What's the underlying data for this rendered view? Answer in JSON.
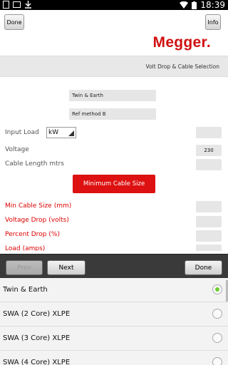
{
  "statusbar": {
    "time": "18:39"
  },
  "toolbar": {
    "done_label": "Done",
    "info_label": "Info"
  },
  "brand": {
    "logo_text": "Megger",
    "logo_dot": "."
  },
  "header": {
    "title": "Volt Drop & Cable Selection"
  },
  "form": {
    "cable_type": "Twin & Earth",
    "ref_method": "Ref method B",
    "input_load_label": "Input Load",
    "input_load_unit": "kW",
    "input_load_value": "",
    "voltage_label": "Voltage",
    "voltage_value": "230",
    "cable_length_label": "Cable Length mtrs",
    "cable_length_value": "",
    "min_cable_button": "Minimum Cable Size",
    "results": [
      {
        "label": "Min Cable Size",
        "unit": "(mm)",
        "value": ""
      },
      {
        "label": "Voltage Drop",
        "unit": "(volts)",
        "value": ""
      },
      {
        "label": "Percent Drop",
        "unit": "(%)",
        "value": ""
      },
      {
        "label": "Load",
        "unit": "(amps)",
        "value": ""
      }
    ]
  },
  "keyboard_bar": {
    "prev_label": "Prev",
    "next_label": "Next",
    "done_label": "Done"
  },
  "picker": {
    "options": [
      {
        "label": "Twin & Earth",
        "selected": true
      },
      {
        "label": "SWA (2 Core) XLPE",
        "selected": false
      },
      {
        "label": "SWA (3 Core) XLPE",
        "selected": false
      },
      {
        "label": "SWA (4 Core) XLPE",
        "selected": false
      }
    ]
  },
  "colors": {
    "brand_red": "#dd1111",
    "radio_selected": "#6bd030"
  }
}
